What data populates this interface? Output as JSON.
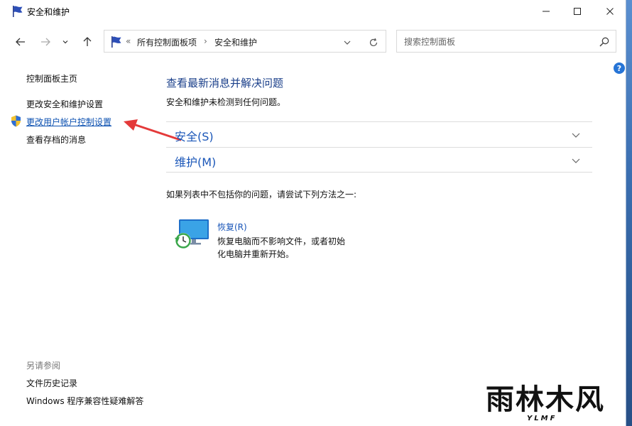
{
  "window": {
    "title": "安全和维护"
  },
  "address_bar": {
    "prefix": "«",
    "crumbs": [
      "所有控制面板项",
      "›",
      "安全和维护"
    ]
  },
  "search": {
    "placeholder": "搜索控制面板"
  },
  "help": {
    "label": "?"
  },
  "sidebar": {
    "links": [
      "控制面板主页",
      "更改安全和维护设置",
      "更改用户帐户控制设置",
      "查看存档的消息"
    ],
    "see_also_heading": "另请参阅",
    "see_also": [
      "文件历史记录",
      "Windows 程序兼容性疑难解答"
    ]
  },
  "main": {
    "title": "查看最新消息并解决问题",
    "subtitle": "安全和维护未检测到任何问题。",
    "sections": [
      "安全(S)",
      "维护(M)"
    ],
    "hint": "如果列表中不包括你的问题，请尝试下列方法之一:",
    "recovery": {
      "link": "恢复(R)",
      "description": "恢复电脑而不影响文件，或者初始化电脑并重新开始。"
    }
  },
  "watermark": {
    "main": "雨林木风",
    "sub": "YLMF"
  },
  "colors": {
    "link_blue": "#1a56b8",
    "title_blue": "#1a3f8a",
    "annotation_arrow": "#e43a3a",
    "desktop": "#3f6fa8"
  }
}
